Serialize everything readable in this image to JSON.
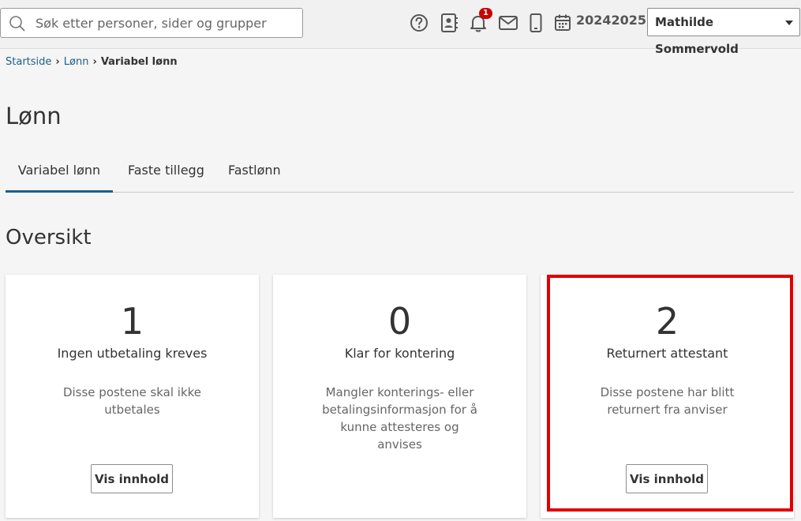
{
  "search": {
    "placeholder": "Søk etter personer, sider og grupper"
  },
  "topbar": {
    "icons": [
      "help-icon",
      "contact-card-icon",
      "bell-icon",
      "mail-icon",
      "phone-icon",
      "calendar-icon"
    ],
    "notification_count": "1",
    "year": "20242025",
    "user_name": "Mathilde Sommervold"
  },
  "breadcrumb": {
    "home": "Startside",
    "section": "Lønn",
    "current": "Variabel lønn"
  },
  "page": {
    "title": "Lønn",
    "overview_heading": "Oversikt"
  },
  "tabs": [
    {
      "label": "Variabel lønn",
      "active": true
    },
    {
      "label": "Faste tillegg",
      "active": false
    },
    {
      "label": "Fastlønn",
      "active": false
    }
  ],
  "cards": [
    {
      "count": "1",
      "title": "Ingen utbetaling kreves",
      "description": "Disse postene skal ikke utbetales",
      "button": "Vis innhold"
    },
    {
      "count": "0",
      "title": "Klar for kontering",
      "description": "Mangler konterings- eller betalingsinformasjon for å kunne attesteres og anvises",
      "button": "Vis innhold"
    },
    {
      "count": "2",
      "title": "Returnert attestant",
      "description": "Disse postene har blitt returnert fra anviser",
      "button": "Vis innhold"
    }
  ],
  "colors": {
    "link": "#1f5f8b",
    "active_tab": "#1d5f8b",
    "highlight": "#e00000",
    "badge": "#cc0000"
  }
}
